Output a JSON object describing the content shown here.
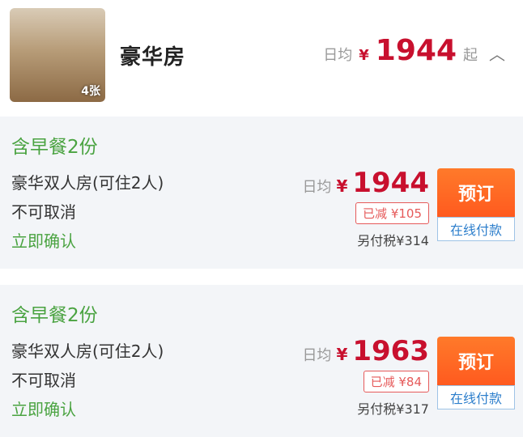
{
  "header": {
    "image_count": "4张",
    "room_name": "豪华房",
    "price_prefix": "日均",
    "currency": "¥",
    "price": "1944",
    "price_suffix": "起",
    "collapse_icon": "chevron-up-icon"
  },
  "offers": [
    {
      "meal": "含早餐2份",
      "room_type": "豪华双人房(可住2人)",
      "cancel_policy": "不可取消",
      "confirm": "立即确认",
      "price_prefix": "日均",
      "currency": "¥",
      "price": "1944",
      "discount": "已减 ¥105",
      "tax": "另付税¥314",
      "book_label": "预订",
      "pay_label": "在线付款"
    },
    {
      "meal": "含早餐2份",
      "room_type": "豪华双人房(可住2人)",
      "cancel_policy": "不可取消",
      "confirm": "立即确认",
      "price_prefix": "日均",
      "currency": "¥",
      "price": "1963",
      "discount": "已减 ¥84",
      "tax": "另付税¥317",
      "book_label": "预订",
      "pay_label": "在线付款"
    }
  ],
  "colors": {
    "price_red": "#c8102e",
    "meal_green": "#4aa341",
    "book_orange": "#ff5a1f",
    "pay_blue": "#2e7fcc"
  }
}
